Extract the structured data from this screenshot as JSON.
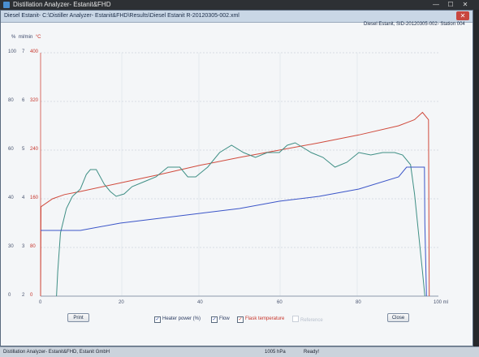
{
  "outer_window": {
    "title": "Distillation Analyzer- Estanit&FHD"
  },
  "window": {
    "title": "Diesel Estanit- C:\\Distiller Analyzer- Estanit&FHD\\Results\\Diesel Estanit R-20120305-002.xml"
  },
  "sample_info": "Diesel Estanit, SID-20120305-002- Station 004",
  "axes_header": {
    "pct": "%",
    "mlmin": "ml/min",
    "temp": "°C"
  },
  "chart_data": {
    "type": "line",
    "xlabel": "ml",
    "xlim": [
      0,
      100
    ],
    "x_ticks": [
      "0",
      "20",
      "40",
      "60",
      "80",
      "100 ml"
    ],
    "y_axes": [
      {
        "unit": "%",
        "ticks": [
          "100",
          "80",
          "60",
          "40",
          "30",
          "0"
        ]
      },
      {
        "unit": "ml/min",
        "ticks": [
          "7",
          "6",
          "5",
          "4",
          "3",
          "2"
        ]
      },
      {
        "unit": "°C",
        "ticks": [
          "400",
          "320",
          "240",
          "160",
          "80",
          "0"
        ]
      }
    ],
    "grid": true,
    "series": [
      {
        "name": "Flask temperature",
        "axis": "°C",
        "color": "#d04a3c",
        "x": [
          0,
          0.1,
          3,
          6,
          10,
          20,
          30,
          40,
          50,
          60,
          70,
          80,
          90,
          94,
          96,
          97.5,
          97.7
        ],
        "y": [
          0,
          147,
          160,
          167,
          172,
          186,
          200,
          215,
          228,
          240,
          252,
          265,
          280,
          290,
          302,
          290,
          0
        ]
      },
      {
        "name": "Flow",
        "axis": "ml/min",
        "color": "#3f8f85",
        "x": [
          4,
          4.3,
          5,
          6.5,
          8,
          10,
          11.5,
          12.5,
          14,
          16,
          17.5,
          19,
          21,
          23,
          26,
          29,
          32,
          35,
          37,
          39,
          42,
          45,
          48,
          51,
          54,
          57,
          60,
          62,
          64,
          66,
          68,
          71,
          74,
          77,
          80,
          83,
          86,
          89,
          91,
          93,
          94,
          95,
          96,
          96.6
        ],
        "y": [
          2,
          2.5,
          3.3,
          3.8,
          4.05,
          4.2,
          4.5,
          4.6,
          4.6,
          4.3,
          4.15,
          4.05,
          4.1,
          4.25,
          4.35,
          4.45,
          4.65,
          4.65,
          4.45,
          4.45,
          4.65,
          4.95,
          5.1,
          4.95,
          4.85,
          4.95,
          4.95,
          5.1,
          5.15,
          5.05,
          4.95,
          4.85,
          4.65,
          4.75,
          4.95,
          4.9,
          4.95,
          4.95,
          4.9,
          4.7,
          4.1,
          3.3,
          2.5,
          2
        ]
      },
      {
        "name": "Heater power (%)",
        "axis": "%",
        "color": "#3b55c8",
        "x": [
          0,
          10,
          20,
          30,
          40,
          50,
          60,
          70,
          80,
          90,
          92,
          96,
          96.5,
          96.6,
          97
        ],
        "y": [
          27,
          27,
          30,
          32,
          34,
          36,
          39,
          41,
          44,
          49,
          53,
          53,
          53,
          30,
          0
        ]
      }
    ]
  },
  "buttons": {
    "print": "Print",
    "close": "Close"
  },
  "legend": {
    "heater": {
      "label": "Heater power (%)",
      "checked": true
    },
    "flow": {
      "label": "Flow",
      "checked": true
    },
    "flask": {
      "label": "Flask temperature",
      "checked": true
    },
    "reference": {
      "label": "Reference",
      "checked": false
    }
  },
  "status_bar": {
    "app": "Distillation Analyzer- Estanit&FHD, Estanit GmbH",
    "pressure": "1005 hPa",
    "state": "Ready!"
  }
}
